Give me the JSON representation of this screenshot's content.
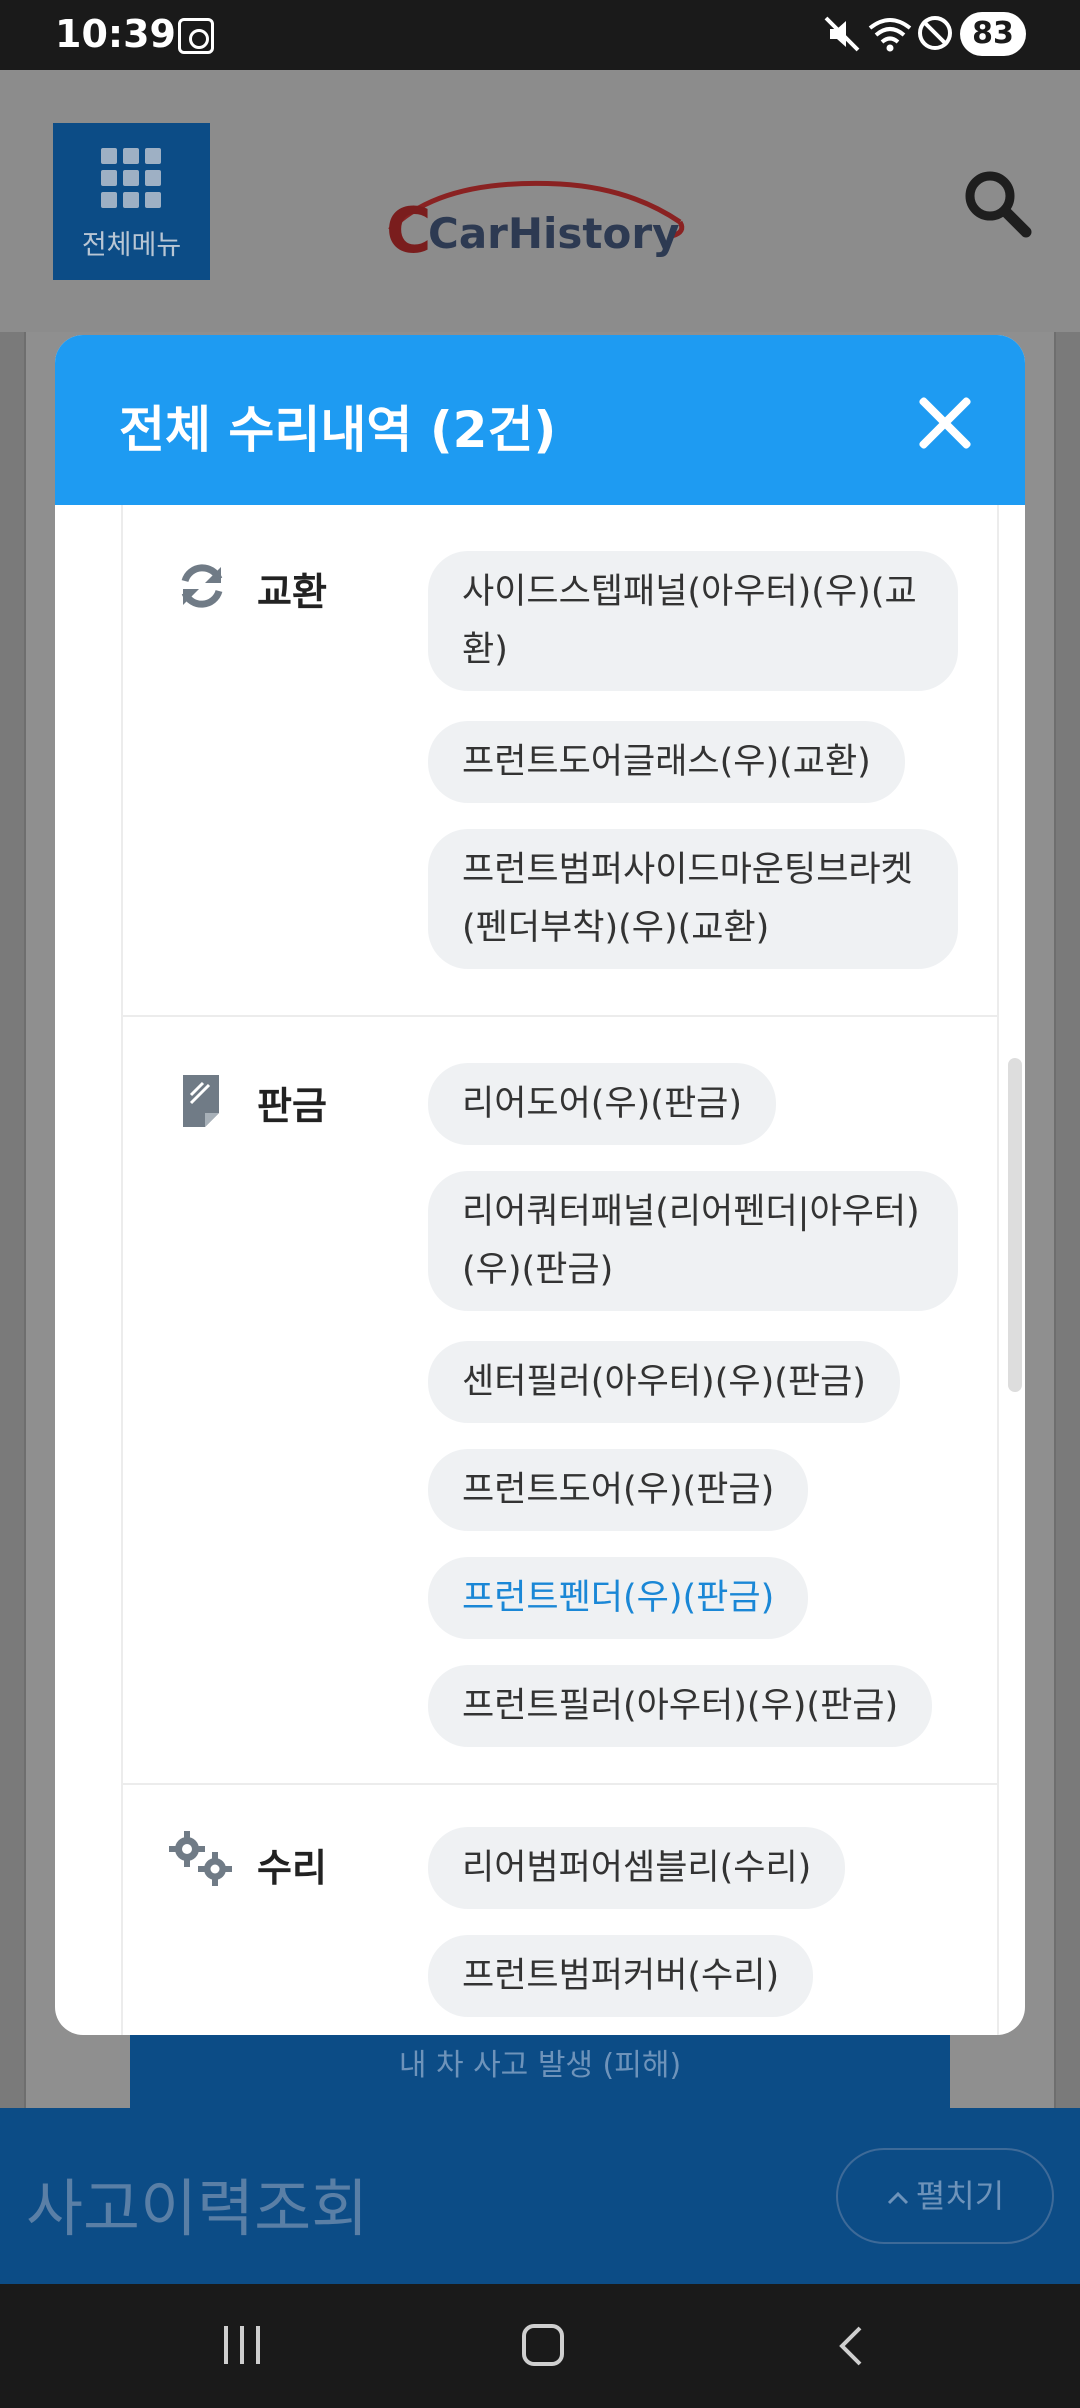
{
  "status_bar": {
    "time": "10:39",
    "battery": "83",
    "icons": [
      "screenshot-icon",
      "mute-icon",
      "wifi-icon",
      "do-not-disturb-icon",
      "battery-icon"
    ]
  },
  "header": {
    "menu_label": "전체메뉴",
    "logo_text": "CarHistory",
    "search_icon": "search-icon"
  },
  "modal": {
    "title": "전체 수리내역 (2건)",
    "sections": [
      {
        "icon": "exchange-icon",
        "label": "교환",
        "items": [
          "사이드스텝패널(아우터)(우)(교환)",
          "프런트도어글래스(우)(교환)",
          "프런트범퍼사이드마운팅브라켓(펜더부착)(우)(교환)"
        ]
      },
      {
        "icon": "panel-beating-icon",
        "label": "판금",
        "items": [
          "리어도어(우)(판금)",
          "리어쿼터패널(리어펜더|아우터)(우)(판금)",
          "센터필러(아우터)(우)(판금)",
          "프런트도어(우)(판금)",
          "프런트펜더(우)(판금)",
          "프런트필러(아우터)(우)(판금)"
        ]
      },
      {
        "icon": "gears-icon",
        "label": "수리",
        "items": [
          "리어범퍼어셈블리(수리)",
          "프런트범퍼커버(수리)"
        ]
      }
    ]
  },
  "background": {
    "accident_button": "내 차 사고 발생 (피해)",
    "bottom_title": "사고이력조회",
    "expand_button": "펼치기"
  },
  "colors": {
    "modal_header": "#1e9bf2",
    "brand_blue": "#0c4c86",
    "chip_bg": "#eff1f3",
    "active_chip_text": "#1a87d6"
  }
}
